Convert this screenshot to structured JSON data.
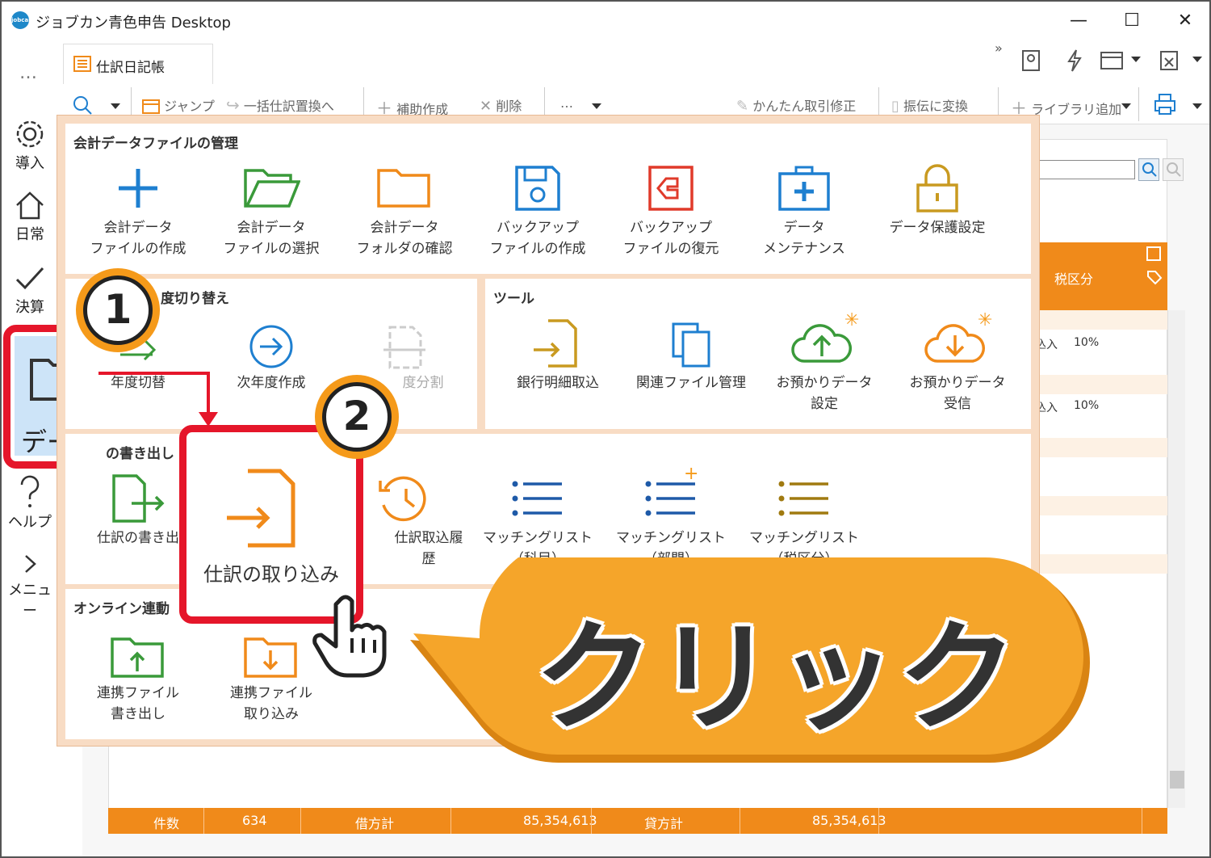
{
  "app": {
    "title": "ジョブカン青色申告 Desktop",
    "logo_text": "jobcan"
  },
  "window": {
    "minimize": "—",
    "maximize": "☐",
    "close": "✕"
  },
  "rail": {
    "more": "…",
    "items": [
      {
        "label": "導入",
        "icon": "gear-icon"
      },
      {
        "label": "日常",
        "icon": "home-icon"
      },
      {
        "label": "決算",
        "icon": "check-icon"
      },
      {
        "label": "データ",
        "icon": "folder-icon"
      },
      {
        "label": "ヘルプ",
        "icon": "help-icon"
      },
      {
        "label": "メニュー",
        "icon": "chevron-right-icon"
      }
    ]
  },
  "tab": {
    "label": "仕訳日記帳",
    "overflow": "»"
  },
  "toolbar": {
    "jump": "ジャンプ",
    "bulk_replace": "一括仕訳置換へ",
    "aux_create": "補助作成",
    "delete": "削除",
    "more": "…",
    "easy_edit": "かんたん取引修正",
    "convert": "振伝に変換",
    "library_add": "ライブラリ追加"
  },
  "popup": {
    "file_mgmt": {
      "title": "会計データファイルの管理",
      "items": [
        {
          "label": "会計データ\nファイルの作成",
          "icon": "plus-icon"
        },
        {
          "label": "会計データ\nファイルの選択",
          "icon": "folder-open-icon"
        },
        {
          "label": "会計データ\nフォルダの確認",
          "icon": "folder-icon"
        },
        {
          "label": "バックアップ\nファイルの作成",
          "icon": "save-icon"
        },
        {
          "label": "バックアップ\nファイルの復元",
          "icon": "restore-icon"
        },
        {
          "label": "データ\nメンテナンス",
          "icon": "first-aid-icon"
        },
        {
          "label": "データ保護設定",
          "icon": "lock-icon"
        }
      ]
    },
    "year_switch": {
      "title": "度切り替え",
      "items": [
        {
          "label": "年度切替",
          "icon": "switch-icon"
        },
        {
          "label": "次年度作成",
          "icon": "arrow-right-circle-icon"
        },
        {
          "label": "度分割",
          "icon": "split-icon"
        }
      ]
    },
    "tools": {
      "title": "ツール",
      "items": [
        {
          "label": "銀行明細取込",
          "icon": "bank-import-icon"
        },
        {
          "label": "関連ファイル管理",
          "icon": "files-icon"
        },
        {
          "label": "お預かりデータ\n設定",
          "icon": "cloud-upload-icon"
        },
        {
          "label": "お預かりデータ\n受信",
          "icon": "cloud-download-icon"
        }
      ]
    },
    "export": {
      "title": "の書き出し",
      "items": [
        {
          "label": "仕訳の書き出",
          "icon": "export-file-icon"
        },
        {
          "label": "仕訳の取り込み",
          "icon": "import-file-icon"
        },
        {
          "label": "仕訳取込履歴",
          "icon": "history-icon"
        },
        {
          "label": "マッチングリスト\n（科目）",
          "icon": "list-icon"
        },
        {
          "label": "マッチングリスト\n（部門）",
          "icon": "list-plus-icon"
        },
        {
          "label": "マッチングリスト\n（税区分）",
          "icon": "list-gold-icon"
        }
      ]
    },
    "online": {
      "title": "オンライン連動",
      "items": [
        {
          "label": "連携ファイル\n書き出し",
          "icon": "folder-upload-icon"
        },
        {
          "label": "連携ファイル\n取り込み",
          "icon": "folder-download-icon"
        }
      ]
    }
  },
  "background": {
    "column_head": "税区分",
    "rows": [
      {
        "a": "込入",
        "b": "10%"
      },
      {
        "a": "込入",
        "b": "10%"
      }
    ],
    "footer": {
      "count_label": "件数",
      "count": "634",
      "debit_label": "借方計",
      "debit": "85,354,613",
      "credit_label": "貸方計",
      "credit": "85,354,613"
    }
  },
  "annotations": {
    "step1": "1",
    "step2": "2",
    "callout": "クリック",
    "data_label": "データ",
    "import_label": "仕訳の取り込み"
  },
  "colors": {
    "accent": "#f08a1a",
    "highlight": "#e5162a",
    "badge": "#f59a1a",
    "blue": "#1e7fd0",
    "green": "#3a9a3a",
    "red": "#e03a2a"
  }
}
